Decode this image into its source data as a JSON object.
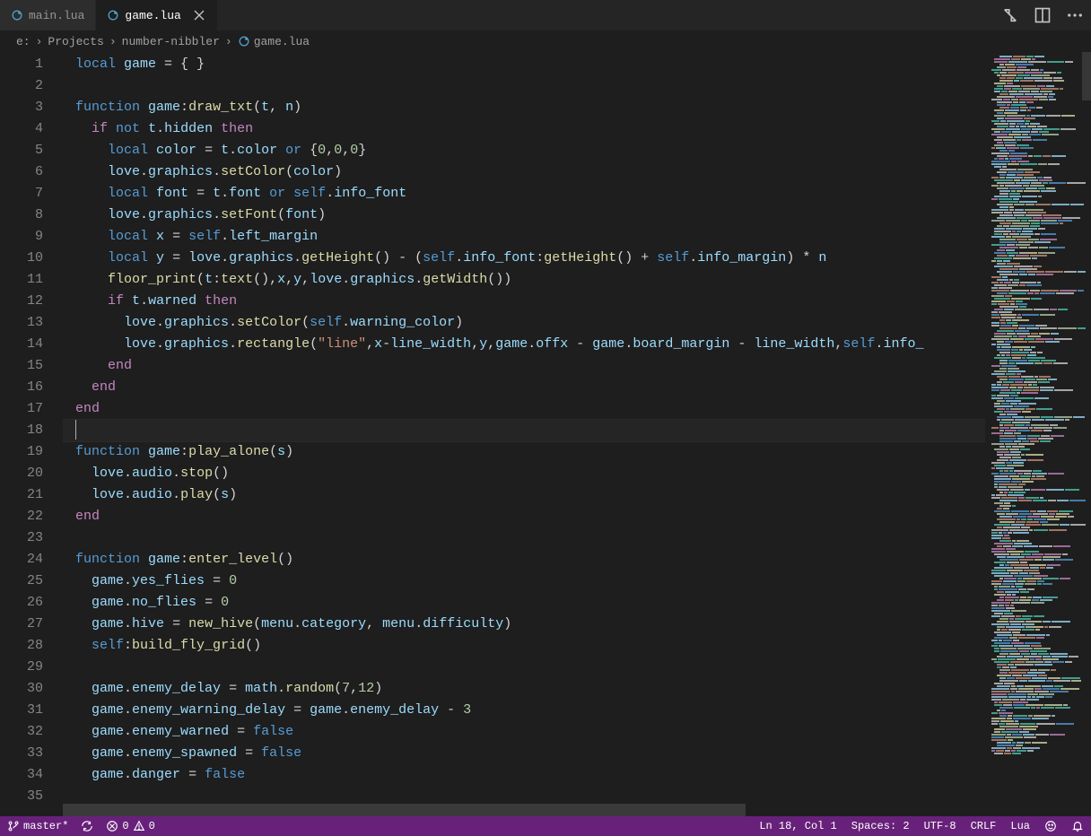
{
  "tabs": [
    {
      "label": "main.lua",
      "active": false
    },
    {
      "label": "game.lua",
      "active": true
    }
  ],
  "breadcrumbs": {
    "segments": [
      "e:",
      "Projects",
      "number-nibbler"
    ],
    "file": "game.lua"
  },
  "gutter": {
    "start": 1,
    "end": 35
  },
  "code": {
    "lines": [
      [
        [
          "kw",
          "local"
        ],
        [
          "op",
          " "
        ],
        [
          "var",
          "game"
        ],
        [
          "punct",
          " = { }"
        ]
      ],
      [],
      [
        [
          "kw",
          "function"
        ],
        [
          "op",
          " "
        ],
        [
          "var",
          "game"
        ],
        [
          "punct",
          ":"
        ],
        [
          "fn",
          "draw_txt"
        ],
        [
          "punct",
          "("
        ],
        [
          "var",
          "t"
        ],
        [
          "punct",
          ", "
        ],
        [
          "var",
          "n"
        ],
        [
          "punct",
          ")"
        ]
      ],
      [
        [
          "op",
          "  "
        ],
        [
          "pink",
          "if"
        ],
        [
          "op",
          " "
        ],
        [
          "kw",
          "not"
        ],
        [
          "op",
          " "
        ],
        [
          "var",
          "t"
        ],
        [
          "punct",
          "."
        ],
        [
          "prop",
          "hidden"
        ],
        [
          "op",
          " "
        ],
        [
          "pink",
          "then"
        ]
      ],
      [
        [
          "op",
          "    "
        ],
        [
          "kw",
          "local"
        ],
        [
          "op",
          " "
        ],
        [
          "var",
          "color"
        ],
        [
          "punct",
          " = "
        ],
        [
          "var",
          "t"
        ],
        [
          "punct",
          "."
        ],
        [
          "prop",
          "color"
        ],
        [
          "op",
          " "
        ],
        [
          "kw",
          "or"
        ],
        [
          "op",
          " {"
        ],
        [
          "num",
          "0"
        ],
        [
          "punct",
          ","
        ],
        [
          "num",
          "0"
        ],
        [
          "punct",
          ","
        ],
        [
          "num",
          "0"
        ],
        [
          "punct",
          "}"
        ]
      ],
      [
        [
          "op",
          "    "
        ],
        [
          "var",
          "love"
        ],
        [
          "punct",
          "."
        ],
        [
          "var",
          "graphics"
        ],
        [
          "punct",
          "."
        ],
        [
          "fn",
          "setColor"
        ],
        [
          "punct",
          "("
        ],
        [
          "var",
          "color"
        ],
        [
          "punct",
          ")"
        ]
      ],
      [
        [
          "op",
          "    "
        ],
        [
          "kw",
          "local"
        ],
        [
          "op",
          " "
        ],
        [
          "var",
          "font"
        ],
        [
          "punct",
          " = "
        ],
        [
          "var",
          "t"
        ],
        [
          "punct",
          "."
        ],
        [
          "prop",
          "font"
        ],
        [
          "op",
          " "
        ],
        [
          "kw",
          "or"
        ],
        [
          "op",
          " "
        ],
        [
          "kw",
          "self"
        ],
        [
          "punct",
          "."
        ],
        [
          "prop",
          "info_font"
        ]
      ],
      [
        [
          "op",
          "    "
        ],
        [
          "var",
          "love"
        ],
        [
          "punct",
          "."
        ],
        [
          "var",
          "graphics"
        ],
        [
          "punct",
          "."
        ],
        [
          "fn",
          "setFont"
        ],
        [
          "punct",
          "("
        ],
        [
          "var",
          "font"
        ],
        [
          "punct",
          ")"
        ]
      ],
      [
        [
          "op",
          "    "
        ],
        [
          "kw",
          "local"
        ],
        [
          "op",
          " "
        ],
        [
          "var",
          "x"
        ],
        [
          "punct",
          " = "
        ],
        [
          "kw",
          "self"
        ],
        [
          "punct",
          "."
        ],
        [
          "prop",
          "left_margin"
        ]
      ],
      [
        [
          "op",
          "    "
        ],
        [
          "kw",
          "local"
        ],
        [
          "op",
          " "
        ],
        [
          "var",
          "y"
        ],
        [
          "punct",
          " = "
        ],
        [
          "var",
          "love"
        ],
        [
          "punct",
          "."
        ],
        [
          "var",
          "graphics"
        ],
        [
          "punct",
          "."
        ],
        [
          "fn",
          "getHeight"
        ],
        [
          "punct",
          "() - ("
        ],
        [
          "kw",
          "self"
        ],
        [
          "punct",
          "."
        ],
        [
          "prop",
          "info_font"
        ],
        [
          "punct",
          ":"
        ],
        [
          "fn",
          "getHeight"
        ],
        [
          "punct",
          "() + "
        ],
        [
          "kw",
          "self"
        ],
        [
          "punct",
          "."
        ],
        [
          "prop",
          "info_margin"
        ],
        [
          "punct",
          ") * "
        ],
        [
          "var",
          "n"
        ]
      ],
      [
        [
          "op",
          "    "
        ],
        [
          "fn",
          "floor_print"
        ],
        [
          "punct",
          "("
        ],
        [
          "var",
          "t"
        ],
        [
          "punct",
          ":"
        ],
        [
          "fn",
          "text"
        ],
        [
          "punct",
          "(),"
        ],
        [
          "var",
          "x"
        ],
        [
          "punct",
          ","
        ],
        [
          "var",
          "y"
        ],
        [
          "punct",
          ","
        ],
        [
          "var",
          "love"
        ],
        [
          "punct",
          "."
        ],
        [
          "var",
          "graphics"
        ],
        [
          "punct",
          "."
        ],
        [
          "fn",
          "getWidth"
        ],
        [
          "punct",
          "())"
        ]
      ],
      [
        [
          "op",
          "    "
        ],
        [
          "pink",
          "if"
        ],
        [
          "op",
          " "
        ],
        [
          "var",
          "t"
        ],
        [
          "punct",
          "."
        ],
        [
          "prop",
          "warned"
        ],
        [
          "op",
          " "
        ],
        [
          "pink",
          "then"
        ]
      ],
      [
        [
          "op",
          "      "
        ],
        [
          "var",
          "love"
        ],
        [
          "punct",
          "."
        ],
        [
          "var",
          "graphics"
        ],
        [
          "punct",
          "."
        ],
        [
          "fn",
          "setColor"
        ],
        [
          "punct",
          "("
        ],
        [
          "kw",
          "self"
        ],
        [
          "punct",
          "."
        ],
        [
          "prop",
          "warning_color"
        ],
        [
          "punct",
          ")"
        ]
      ],
      [
        [
          "op",
          "      "
        ],
        [
          "var",
          "love"
        ],
        [
          "punct",
          "."
        ],
        [
          "var",
          "graphics"
        ],
        [
          "punct",
          "."
        ],
        [
          "fn",
          "rectangle"
        ],
        [
          "punct",
          "("
        ],
        [
          "str",
          "\"line\""
        ],
        [
          "punct",
          ","
        ],
        [
          "var",
          "x"
        ],
        [
          "punct",
          "-"
        ],
        [
          "var",
          "line_width"
        ],
        [
          "punct",
          ","
        ],
        [
          "var",
          "y"
        ],
        [
          "punct",
          ","
        ],
        [
          "var",
          "game"
        ],
        [
          "punct",
          "."
        ],
        [
          "prop",
          "offx"
        ],
        [
          "punct",
          " - "
        ],
        [
          "var",
          "game"
        ],
        [
          "punct",
          "."
        ],
        [
          "prop",
          "board_margin"
        ],
        [
          "punct",
          " - "
        ],
        [
          "var",
          "line_width"
        ],
        [
          "punct",
          ","
        ],
        [
          "kw",
          "self"
        ],
        [
          "punct",
          "."
        ],
        [
          "prop",
          "info_"
        ]
      ],
      [
        [
          "op",
          "    "
        ],
        [
          "pink",
          "end"
        ]
      ],
      [
        [
          "op",
          "  "
        ],
        [
          "pink",
          "end"
        ]
      ],
      [
        [
          "pink",
          "end"
        ]
      ],
      [],
      [
        [
          "kw",
          "function"
        ],
        [
          "op",
          " "
        ],
        [
          "var",
          "game"
        ],
        [
          "punct",
          ":"
        ],
        [
          "fn",
          "play_alone"
        ],
        [
          "punct",
          "("
        ],
        [
          "var",
          "s"
        ],
        [
          "punct",
          ")"
        ]
      ],
      [
        [
          "op",
          "  "
        ],
        [
          "var",
          "love"
        ],
        [
          "punct",
          "."
        ],
        [
          "var",
          "audio"
        ],
        [
          "punct",
          "."
        ],
        [
          "fn",
          "stop"
        ],
        [
          "punct",
          "()"
        ]
      ],
      [
        [
          "op",
          "  "
        ],
        [
          "var",
          "love"
        ],
        [
          "punct",
          "."
        ],
        [
          "var",
          "audio"
        ],
        [
          "punct",
          "."
        ],
        [
          "fn",
          "play"
        ],
        [
          "punct",
          "("
        ],
        [
          "var",
          "s"
        ],
        [
          "punct",
          ")"
        ]
      ],
      [
        [
          "pink",
          "end"
        ]
      ],
      [],
      [
        [
          "kw",
          "function"
        ],
        [
          "op",
          " "
        ],
        [
          "var",
          "game"
        ],
        [
          "punct",
          ":"
        ],
        [
          "fn",
          "enter_level"
        ],
        [
          "punct",
          "()"
        ]
      ],
      [
        [
          "op",
          "  "
        ],
        [
          "var",
          "game"
        ],
        [
          "punct",
          "."
        ],
        [
          "prop",
          "yes_flies"
        ],
        [
          "punct",
          " = "
        ],
        [
          "num",
          "0"
        ]
      ],
      [
        [
          "op",
          "  "
        ],
        [
          "var",
          "game"
        ],
        [
          "punct",
          "."
        ],
        [
          "prop",
          "no_flies"
        ],
        [
          "punct",
          " = "
        ],
        [
          "num",
          "0"
        ]
      ],
      [
        [
          "op",
          "  "
        ],
        [
          "var",
          "game"
        ],
        [
          "punct",
          "."
        ],
        [
          "prop",
          "hive"
        ],
        [
          "punct",
          " = "
        ],
        [
          "fn",
          "new_hive"
        ],
        [
          "punct",
          "("
        ],
        [
          "var",
          "menu"
        ],
        [
          "punct",
          "."
        ],
        [
          "prop",
          "category"
        ],
        [
          "punct",
          ", "
        ],
        [
          "var",
          "menu"
        ],
        [
          "punct",
          "."
        ],
        [
          "prop",
          "difficulty"
        ],
        [
          "punct",
          ")"
        ]
      ],
      [
        [
          "op",
          "  "
        ],
        [
          "kw",
          "self"
        ],
        [
          "punct",
          ":"
        ],
        [
          "fn",
          "build_fly_grid"
        ],
        [
          "punct",
          "()"
        ]
      ],
      [],
      [
        [
          "op",
          "  "
        ],
        [
          "var",
          "game"
        ],
        [
          "punct",
          "."
        ],
        [
          "prop",
          "enemy_delay"
        ],
        [
          "punct",
          " = "
        ],
        [
          "var",
          "math"
        ],
        [
          "punct",
          "."
        ],
        [
          "fn",
          "random"
        ],
        [
          "punct",
          "("
        ],
        [
          "num",
          "7"
        ],
        [
          "punct",
          ","
        ],
        [
          "num",
          "12"
        ],
        [
          "punct",
          ")"
        ]
      ],
      [
        [
          "op",
          "  "
        ],
        [
          "var",
          "game"
        ],
        [
          "punct",
          "."
        ],
        [
          "prop",
          "enemy_warning_delay"
        ],
        [
          "punct",
          " = "
        ],
        [
          "var",
          "game"
        ],
        [
          "punct",
          "."
        ],
        [
          "prop",
          "enemy_delay"
        ],
        [
          "punct",
          " - "
        ],
        [
          "num",
          "3"
        ]
      ],
      [
        [
          "op",
          "  "
        ],
        [
          "var",
          "game"
        ],
        [
          "punct",
          "."
        ],
        [
          "prop",
          "enemy_warned"
        ],
        [
          "punct",
          " = "
        ],
        [
          "kw",
          "false"
        ]
      ],
      [
        [
          "op",
          "  "
        ],
        [
          "var",
          "game"
        ],
        [
          "punct",
          "."
        ],
        [
          "prop",
          "enemy_spawned"
        ],
        [
          "punct",
          " = "
        ],
        [
          "kw",
          "false"
        ]
      ],
      [
        [
          "op",
          "  "
        ],
        [
          "var",
          "game"
        ],
        [
          "punct",
          "."
        ],
        [
          "prop",
          "danger"
        ],
        [
          "punct",
          " = "
        ],
        [
          "kw",
          "false"
        ]
      ],
      []
    ],
    "current_line_index": 17
  },
  "status": {
    "branch": "master*",
    "errors": "0",
    "warnings": "0",
    "cursor": "Ln 18, Col 1",
    "spaces": "Spaces: 2",
    "encoding": "UTF-8",
    "eol": "CRLF",
    "language": "Lua"
  },
  "token_colors": {
    "kw": "#569cd6",
    "pink": "#c586c0",
    "fn": "#dcdcaa",
    "var": "#9cdcfe",
    "prop": "#9cdcfe",
    "num": "#b5cea8",
    "str": "#ce9178",
    "punct": "#d4d4d4",
    "op": "#d4d4d4",
    "obj": "#4ec9b0"
  },
  "minimap_count": 260,
  "minimap_blocks_per_line": 6
}
